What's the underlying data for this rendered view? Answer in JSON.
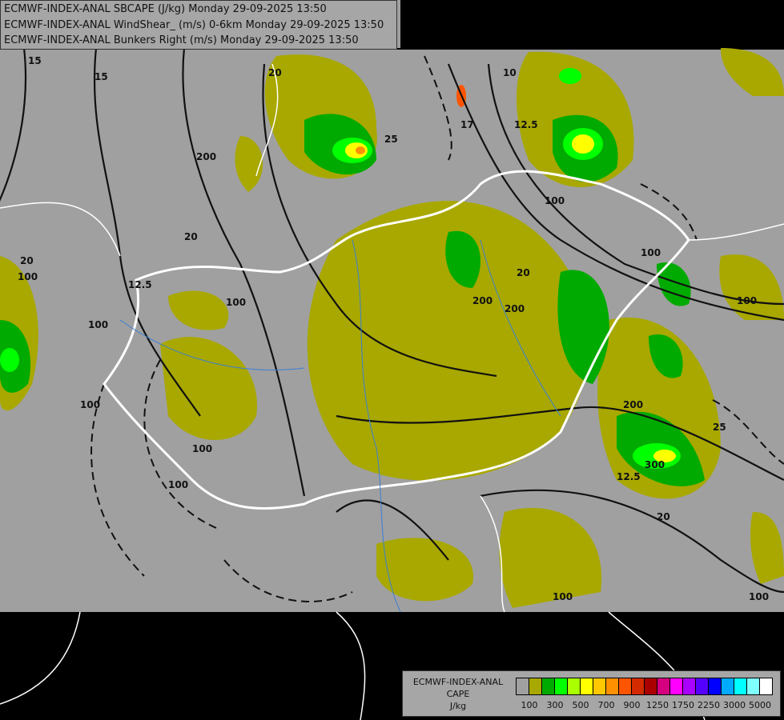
{
  "header": {
    "lines": [
      "ECMWF-INDEX-ANAL SBCAPE (J/kg) Monday 29-09-2025 13:50",
      "ECMWF-INDEX-ANAL WindShear_ (m/s) 0-6km Monday 29-09-2025 13:50",
      "ECMWF-INDEX-ANAL Bunkers Right (m/s) Monday 29-09-2025 13:50"
    ]
  },
  "legend": {
    "title_lines": [
      "ECMWF-INDEX-ANAL",
      "CAPE",
      "J/kg"
    ],
    "colors": [
      "#a0a0a0",
      "#a8a800",
      "#00aa00",
      "#00ff00",
      "#aaff00",
      "#ffff00",
      "#ffc800",
      "#ff9100",
      "#ff5500",
      "#d42a00",
      "#aa0000",
      "#d4007f",
      "#ff00ff",
      "#aa00ff",
      "#5500ff",
      "#0000ff",
      "#00aaff",
      "#00ffff",
      "#80ffff",
      "#ffffff"
    ],
    "labels": [
      "100",
      "300",
      "500",
      "700",
      "900",
      "1250",
      "1750",
      "2250",
      "3000",
      "5000"
    ]
  },
  "map": {
    "background_color": "#a0a0a0",
    "border_color": "#ffffff",
    "river_color": "#3a7fd5",
    "contour_labels": [
      "15",
      "15",
      "20",
      "25",
      "17",
      "12.5",
      "10",
      "20",
      "12.5",
      "20",
      "20",
      "25",
      "20",
      "12.5",
      "100",
      "200",
      "100",
      "100",
      "200",
      "200",
      "100",
      "200",
      "100",
      "100",
      "100",
      "100",
      "100",
      "300",
      "100",
      "100"
    ]
  }
}
